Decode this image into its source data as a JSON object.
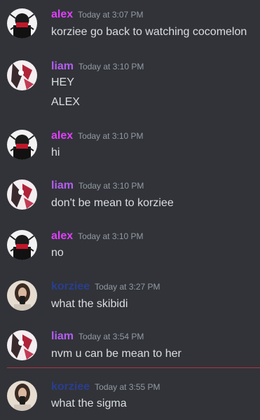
{
  "colors": {
    "background": "#313338",
    "text": "#dbdee1",
    "timestamp": "#949ba4",
    "unread_divider": "#b4333d"
  },
  "users": {
    "alex": {
      "name": "alex",
      "color": "#e040fb",
      "avatar": "alex-avatar"
    },
    "liam": {
      "name": "liam",
      "color": "#b45ef0",
      "avatar": "liam-avatar"
    },
    "korziee": {
      "name": "korziee",
      "color": "#2a3e8e",
      "avatar": "korziee-avatar"
    }
  },
  "messages": [
    {
      "author": "alex",
      "timestamp": "Today at 3:07 PM",
      "lines": [
        "korziee go back to watching cocomelon"
      ]
    },
    {
      "author": "liam",
      "timestamp": "Today at 3:10 PM",
      "lines": [
        "HEY",
        "ALEX"
      ]
    },
    {
      "author": "alex",
      "timestamp": "Today at 3:10 PM",
      "lines": [
        "hi"
      ]
    },
    {
      "author": "liam",
      "timestamp": "Today at 3:10 PM",
      "lines": [
        "don't be mean to korziee"
      ]
    },
    {
      "author": "alex",
      "timestamp": "Today at 3:10 PM",
      "lines": [
        "no"
      ]
    },
    {
      "author": "korziee",
      "timestamp": "Today at 3:27 PM",
      "lines": [
        "what the skibidi"
      ]
    },
    {
      "author": "liam",
      "timestamp": "Today at 3:54 PM",
      "lines": [
        "nvm u can be mean to her"
      ]
    },
    {
      "author": "korziee",
      "timestamp": "Today at 3:55 PM",
      "lines": [
        "what the sigma"
      ]
    }
  ]
}
